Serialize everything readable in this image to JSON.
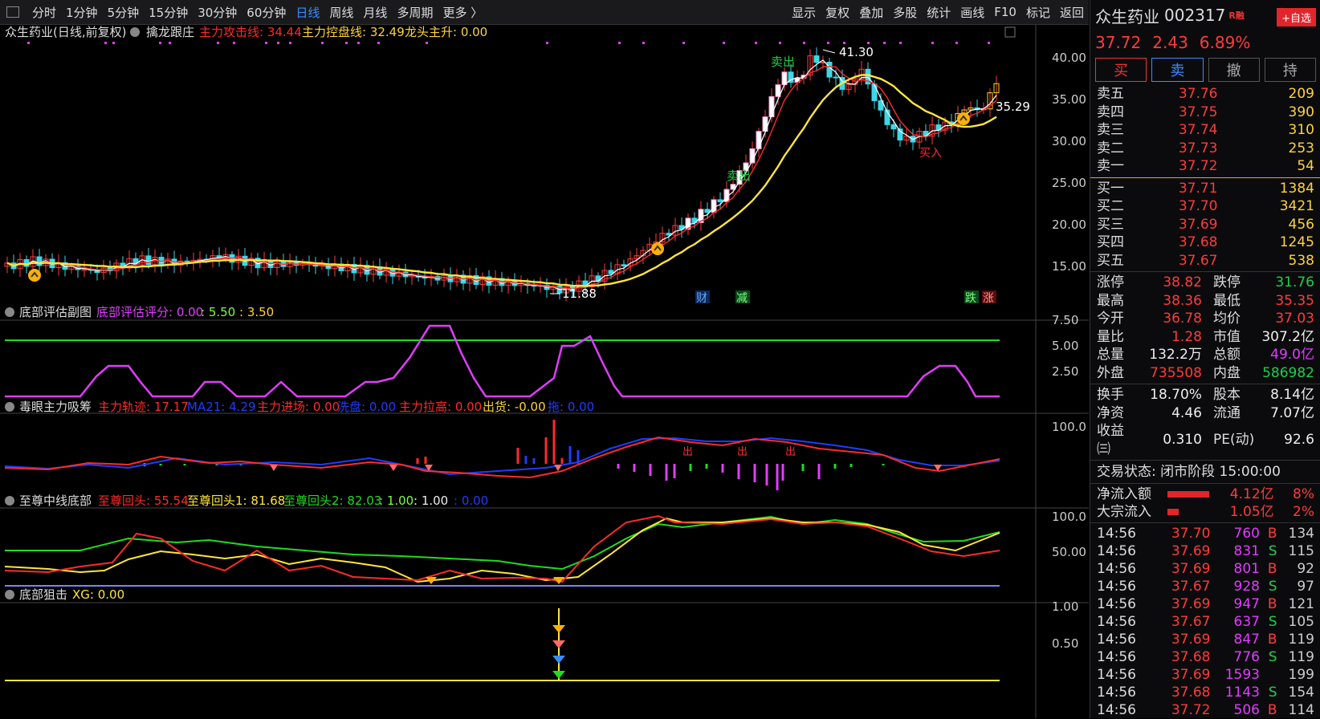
{
  "toolbar": {
    "periods": [
      "分时",
      "1分钟",
      "5分钟",
      "15分钟",
      "30分钟",
      "60分钟",
      "日线",
      "周线",
      "月线",
      "多周期",
      "更多 〉"
    ],
    "active": "日线",
    "right": [
      "显示",
      "复权",
      "叠加",
      "多股",
      "统计",
      "画线",
      "F10",
      "标记",
      "返回"
    ]
  },
  "main": {
    "title": "众生药业(日线,前复权)",
    "indicator": "擒龙跟庄",
    "l1": "主力攻击线: 34.44",
    "l2": "主力控盘线: 32.49",
    "l3": "龙头主升: 0.00",
    "yticks": [
      "40.00",
      "35.00",
      "30.00",
      "25.00",
      "20.00",
      "15.00"
    ],
    "high_label": "41.30",
    "low_label": "11.88",
    "cur_label": "35.29",
    "sell1": "卖出",
    "sell2": "卖出",
    "buy_mark": "买入",
    "tags": [
      "财",
      "减",
      "跌",
      "涨"
    ]
  },
  "p1": {
    "title": "底部评估副图",
    "v1": "底部评估评分: 0.00",
    "v2": ": 5.50",
    "v3": ": 3.50",
    "yticks": [
      "7.50",
      "5.00",
      "2.50"
    ]
  },
  "p2": {
    "title": "毒眼主力吸筹",
    "v1": "主力轨迹: 17.17",
    "v2": "MA21: 4.29",
    "v3": "主力进场: 0.00",
    "v4": "洗盘: 0.00",
    "v5": "主力拉高: 0.00",
    "v6": "出货: -0.00",
    "v7": "拖: 0.00",
    "yticks": [
      "100.0"
    ],
    "out": "出"
  },
  "p3": {
    "title": "至尊中线底部",
    "v1": "至尊回头: 55.54",
    "v2": "至尊回头1: 81.68",
    "v3": "至尊回头2: 82.03",
    "v4": ": 1.00",
    "v5": ": 1.00",
    "v6": ": 0.00",
    "yticks": [
      "100.0",
      "50.00"
    ]
  },
  "p4": {
    "title": "底部狙击",
    "v1": "XG: 0.00",
    "yticks": [
      "1.00",
      "0.50"
    ]
  },
  "side": {
    "name": "众生药业",
    "code": "002317",
    "rz": "R融",
    "add": "+自选",
    "price": "37.72",
    "chg": "2.43",
    "pct": "6.89%",
    "buttons": [
      "买",
      "卖",
      "撤",
      "持"
    ],
    "asks": [
      [
        "卖五",
        "37.76",
        "209"
      ],
      [
        "卖四",
        "37.75",
        "390"
      ],
      [
        "卖三",
        "37.74",
        "310"
      ],
      [
        "卖二",
        "37.73",
        "253"
      ],
      [
        "卖一",
        "37.72",
        "54"
      ]
    ],
    "bids": [
      [
        "买一",
        "37.71",
        "1384"
      ],
      [
        "买二",
        "37.70",
        "3421"
      ],
      [
        "买三",
        "37.69",
        "456"
      ],
      [
        "买四",
        "37.68",
        "1245"
      ],
      [
        "买五",
        "37.67",
        "538"
      ]
    ],
    "stats": [
      [
        "涨停",
        "38.82",
        "red",
        "跌停",
        "31.76",
        "green"
      ],
      [
        "最高",
        "38.36",
        "red",
        "最低",
        "35.35",
        "red"
      ],
      [
        "今开",
        "36.78",
        "red",
        "均价",
        "37.03",
        "red"
      ],
      [
        "量比",
        "1.28",
        "red",
        "市值",
        "307.2亿",
        "white"
      ],
      [
        "总量",
        "132.2万",
        "white",
        "总额",
        "49.0亿",
        "mag"
      ],
      [
        "外盘",
        "735508",
        "red",
        "内盘",
        "586982",
        "green"
      ]
    ],
    "stats2": [
      [
        "换手",
        "18.70%",
        "white",
        "股本",
        "8.14亿",
        "white"
      ],
      [
        "净资",
        "4.46",
        "white",
        "流通",
        "7.07亿",
        "white"
      ],
      [
        "收益㈢",
        "0.310",
        "white",
        "PE(动)",
        "92.6",
        "white"
      ]
    ],
    "status": "交易状态: 闭市阶段 15:00:00",
    "flow": [
      [
        "净流入额",
        "4.12亿",
        "8%"
      ],
      [
        "大宗流入",
        "1.05亿",
        "2%"
      ]
    ],
    "trades": [
      [
        "14:56",
        "37.70",
        "760",
        "B",
        "134"
      ],
      [
        "14:56",
        "37.69",
        "831",
        "S",
        "115"
      ],
      [
        "14:56",
        "37.69",
        "801",
        "B",
        "92"
      ],
      [
        "14:56",
        "37.67",
        "928",
        "S",
        "97"
      ],
      [
        "14:56",
        "37.69",
        "947",
        "B",
        "121"
      ],
      [
        "14:56",
        "37.67",
        "637",
        "S",
        "105"
      ],
      [
        "14:56",
        "37.69",
        "847",
        "B",
        "119"
      ],
      [
        "14:56",
        "37.68",
        "776",
        "S",
        "119"
      ],
      [
        "14:56",
        "37.69",
        "1593",
        "",
        "199"
      ],
      [
        "14:56",
        "37.68",
        "1143",
        "S",
        "154"
      ],
      [
        "14:56",
        "37.72",
        "506",
        "B",
        "114"
      ]
    ]
  }
}
